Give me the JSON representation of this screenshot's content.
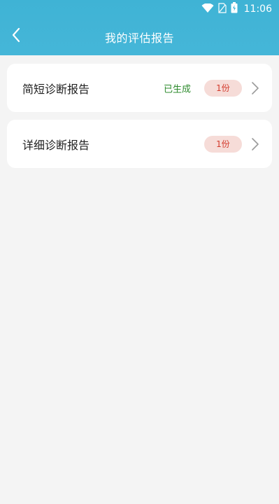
{
  "status_bar": {
    "time": "11:06"
  },
  "header": {
    "title": "我的评估报告",
    "back_icon": "chevron-left-icon"
  },
  "reports": [
    {
      "label": "简短诊断报告",
      "status": "已生成",
      "count": "1份"
    },
    {
      "label": "详细诊断报告",
      "status": "",
      "count": "1份"
    }
  ],
  "colors": {
    "header": "#45b6d8",
    "background": "#f4f4f4",
    "status_text": "#2e8b2e",
    "count_badge_bg": "#f6dcd8",
    "count_badge_text": "#d33a2c"
  }
}
